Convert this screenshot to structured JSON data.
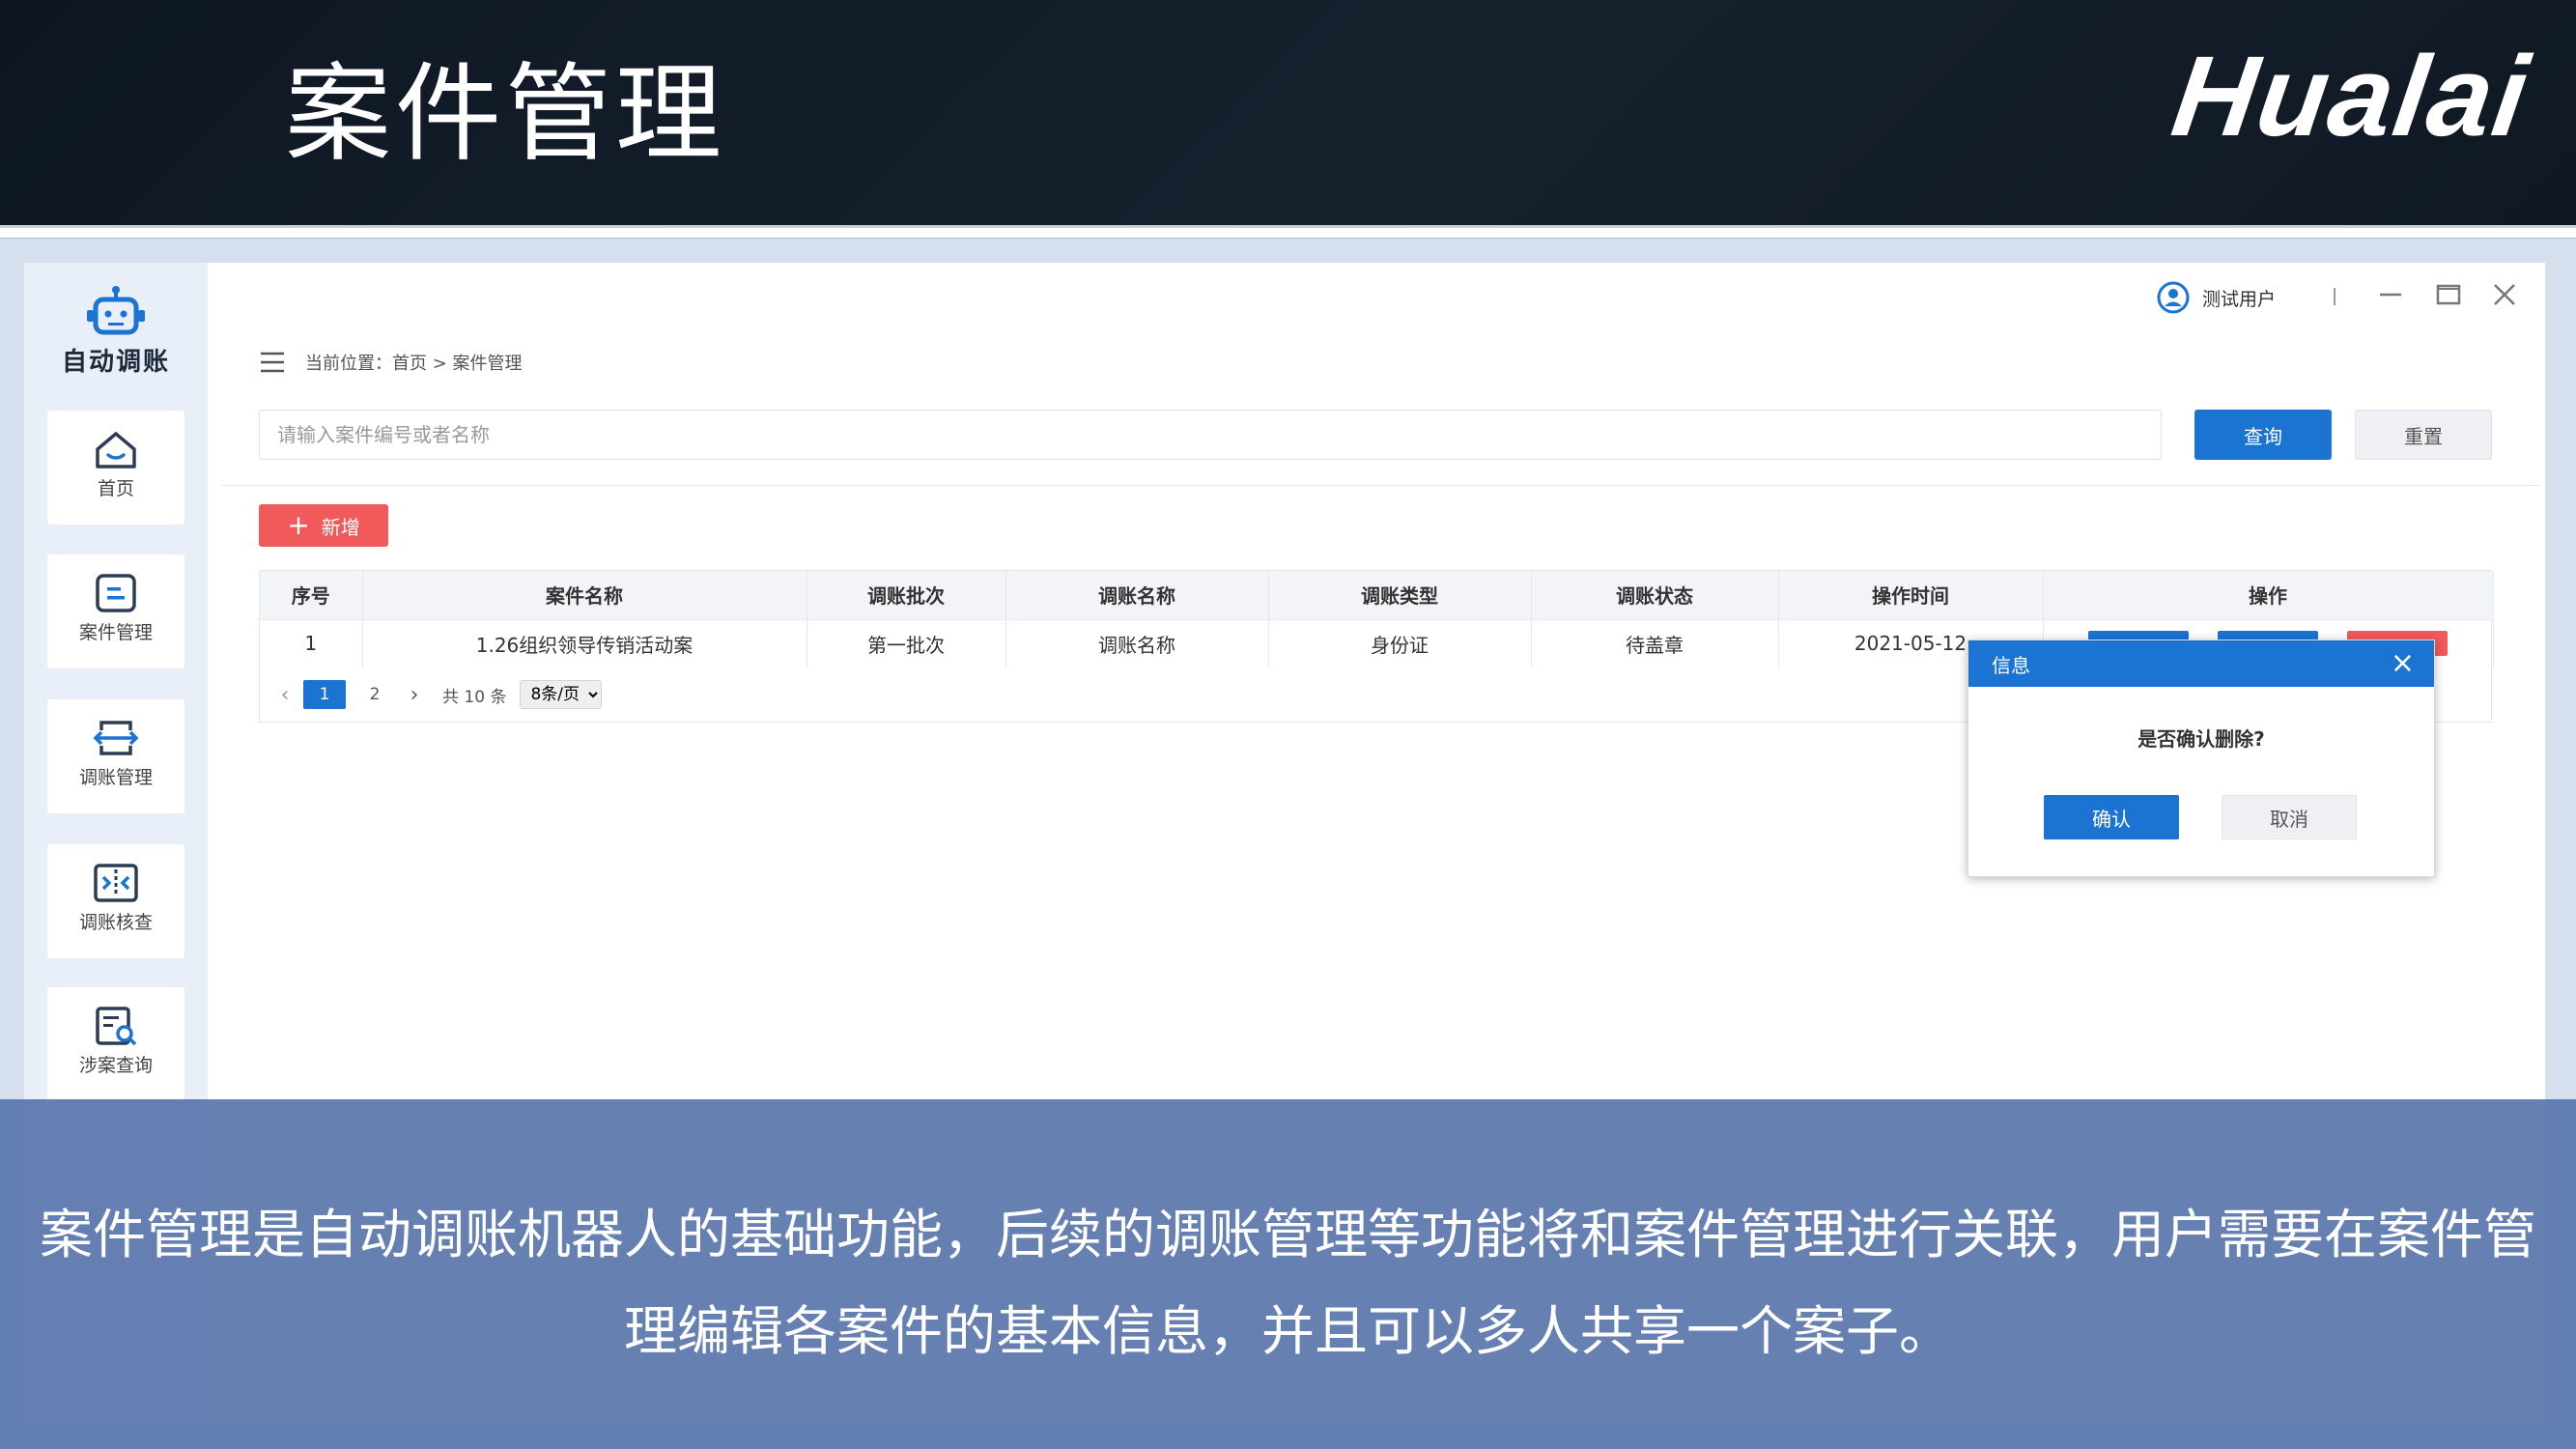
{
  "slide": {
    "title": "案件管理",
    "brand": "Hualai"
  },
  "app": {
    "name": "自动调账",
    "user": "测试用户",
    "breadcrumb": "当前位置：首页 > 案件管理",
    "sidebar": {
      "items": [
        {
          "label": "首页",
          "icon": "home-icon"
        },
        {
          "label": "案件管理",
          "icon": "case-icon"
        },
        {
          "label": "调账管理",
          "icon": "transfer-icon"
        },
        {
          "label": "调账核查",
          "icon": "check-icon"
        },
        {
          "label": "涉案查询",
          "icon": "search-doc-icon"
        }
      ]
    },
    "search": {
      "placeholder": "请输入案件编号或者名称",
      "value": ""
    },
    "buttons": {
      "query": "查询",
      "reset": "重置",
      "add": "新增"
    },
    "table": {
      "columns": [
        "序号",
        "案件名称",
        "调账批次",
        "调账名称",
        "调账类型",
        "调账状态",
        "操作时间",
        "操作"
      ],
      "rows": [
        {
          "index": "1",
          "case_name": "1.26组织领导传销活动案",
          "batch": "第一批次",
          "adjust_name": "调账名称",
          "type": "身份证",
          "status": "待盖章",
          "time": "2021-05-12"
        }
      ]
    },
    "pagination": {
      "pages": [
        "1",
        "2"
      ],
      "current": "1",
      "total": "共 10 条",
      "page_size": "8条/页"
    },
    "dialog": {
      "title": "信息",
      "message": "是否确认删除?",
      "confirm": "确认",
      "cancel": "取消"
    }
  },
  "colors": {
    "primary": "#1b74d2",
    "danger": "#f15a5a",
    "header_bg": "#121c28",
    "caption_bg": "#5a76ac"
  },
  "caption": "案件管理是自动调账机器人的基础功能，后续的调账管理等功能将和案件管理进行关联，用户需要在案件管理编辑各案件的基本信息，并且可以多人共享一个案子。"
}
